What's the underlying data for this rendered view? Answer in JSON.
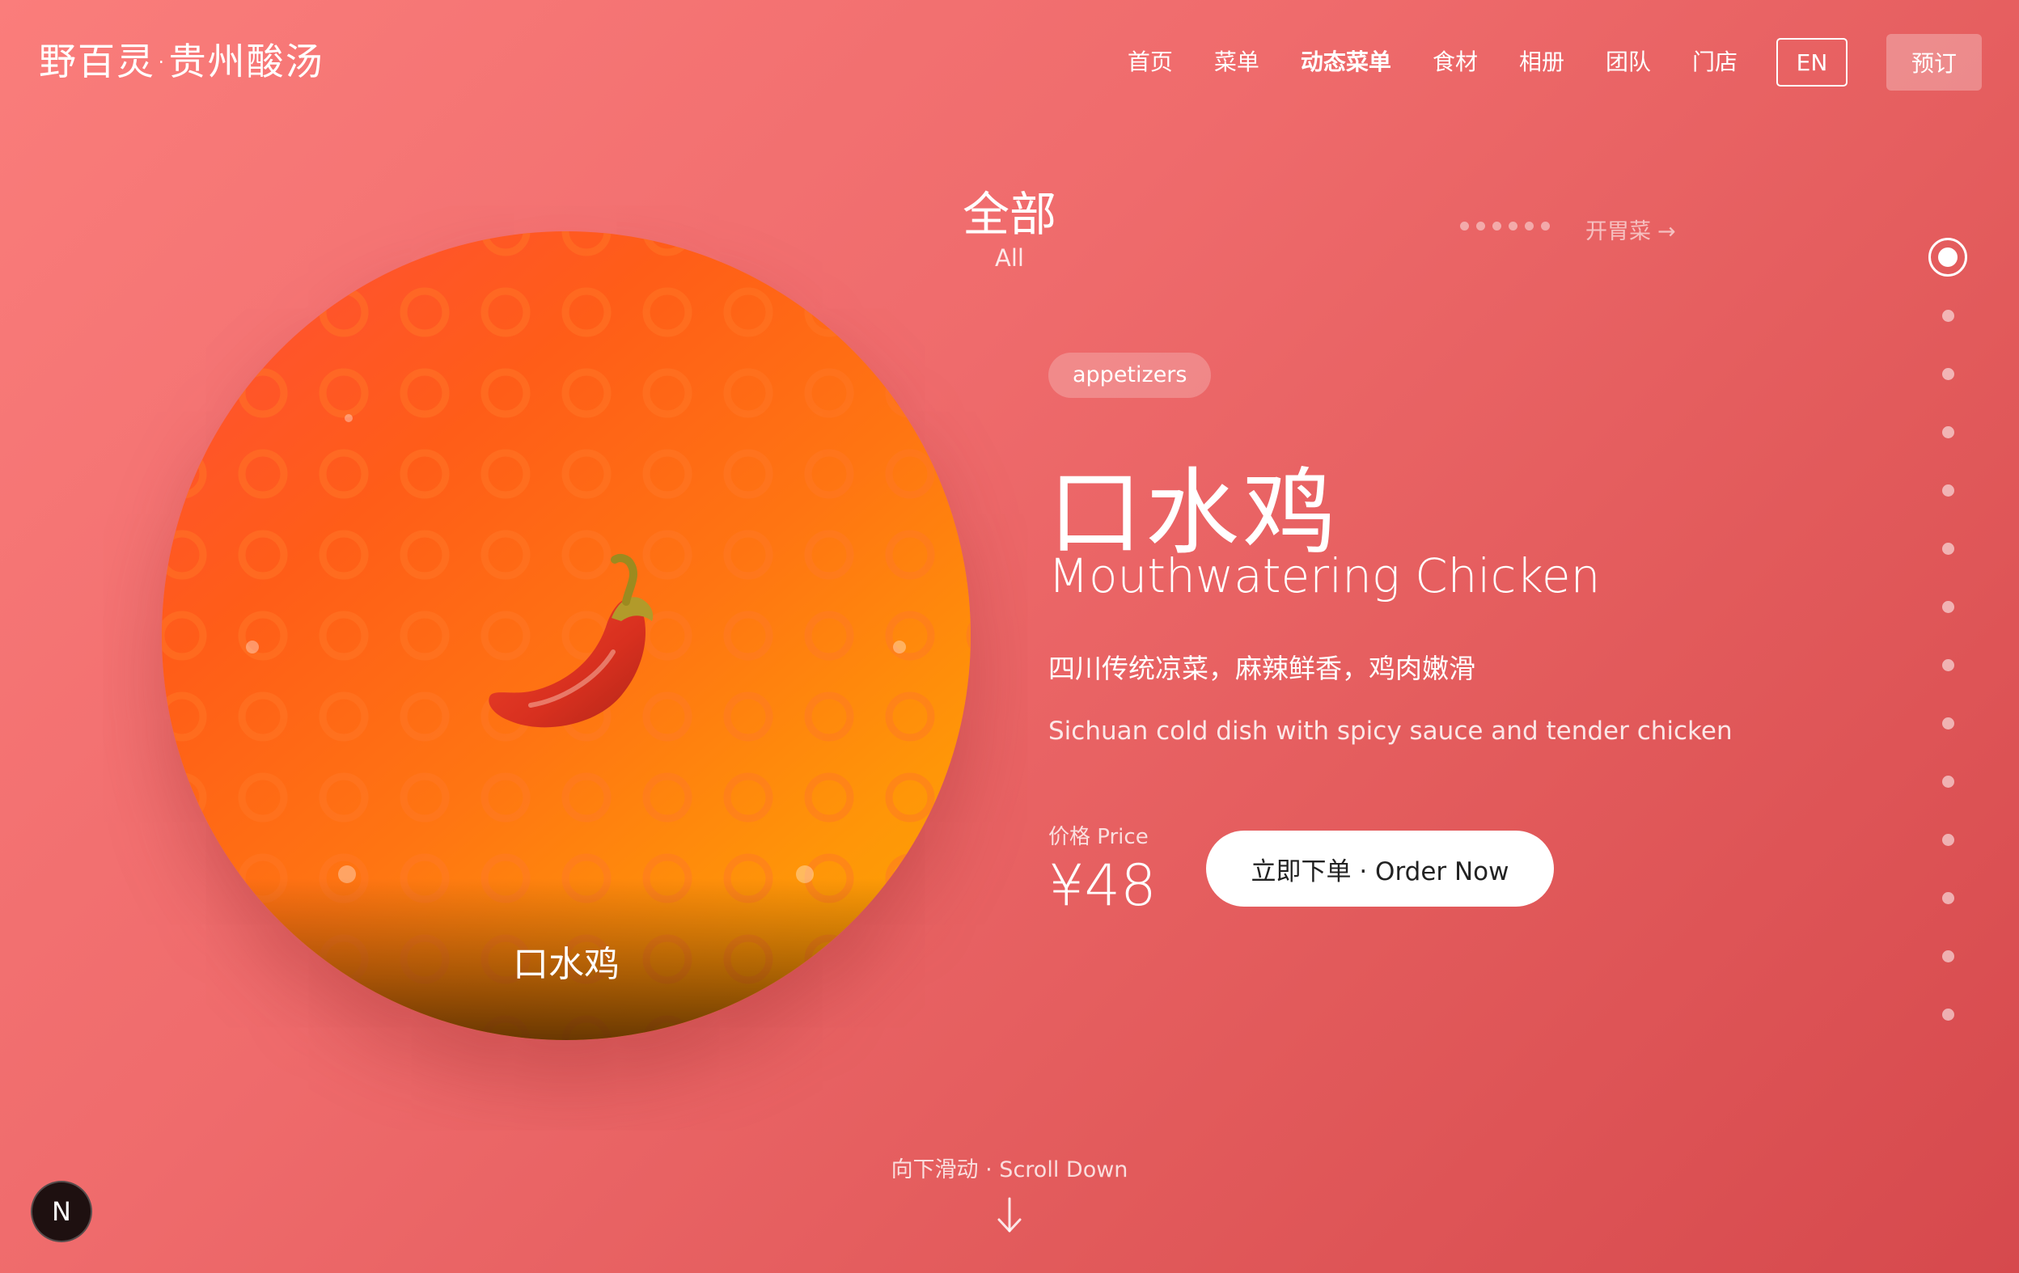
{
  "brand": "野百灵·贵州酸汤",
  "nav": {
    "items": [
      {
        "label": "首页",
        "active": false
      },
      {
        "label": "菜单",
        "active": false
      },
      {
        "label": "动态菜单",
        "active": true
      },
      {
        "label": "食材",
        "active": false
      },
      {
        "label": "相册",
        "active": false
      },
      {
        "label": "团队",
        "active": false
      },
      {
        "label": "门店",
        "active": false
      }
    ],
    "lang": "EN",
    "reserve": "预订"
  },
  "category": {
    "zh": "全部",
    "en": "All",
    "next_label": "开胃菜",
    "next_arrow": "→",
    "dots_count": 6
  },
  "dish": {
    "tag": "appetizers",
    "name_zh": "口水鸡",
    "name_en": "Mouthwatering Chicken",
    "desc_zh": "四川传统凉菜，麻辣鲜香，鸡肉嫩滑",
    "desc_en": "Sichuan cold dish with spicy sauce and tender chicken",
    "price_label": "价格 Price",
    "price": "¥48",
    "order_label": "立即下单 · Order Now",
    "emoji_icon": "chili-pepper-icon",
    "caption": "口水鸡"
  },
  "pager": {
    "count": 14,
    "active_index": 0
  },
  "scroll": {
    "label": "向下滑动 · Scroll Down"
  },
  "badge": "N",
  "colors": {
    "background_start": "#fa7d7b",
    "background_end": "#d6494d",
    "circle_start": "#ff4d3a",
    "circle_end": "#f8a800",
    "order_button": "#ffffff"
  }
}
